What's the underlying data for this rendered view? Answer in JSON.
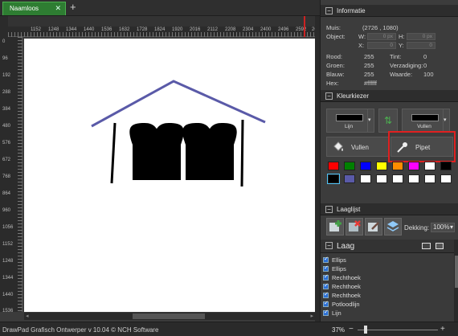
{
  "tab": {
    "title": "Naamloos",
    "close": "✕",
    "add": "+"
  },
  "ruler_top": [
    "1152",
    "1248",
    "1344",
    "1440",
    "1536",
    "1632",
    "1728",
    "1824",
    "1920",
    "2016",
    "2112",
    "2208",
    "2304",
    "2400",
    "2496",
    "2592",
    "2688",
    "27"
  ],
  "ruler_left": [
    "0",
    "96",
    "192",
    "288",
    "384",
    "480",
    "576",
    "672",
    "768",
    "864",
    "960",
    "1056",
    "1152",
    "1248",
    "1344",
    "1440",
    "1536"
  ],
  "statusbar": {
    "text": "DrawPad Grafisch Ontwerper v 10.04 © NCH Software",
    "zoom": "37%",
    "zoom_minus": "−",
    "zoom_plus": "+",
    "zoom_level": 0.08
  },
  "info": {
    "title": "Informatie",
    "muis_label": "Muis:",
    "muis_value": "(2726 , 1080)",
    "object_label": "Object:",
    "w_label": "W:",
    "w_value": "0 px",
    "h_label": "H:",
    "h_value": "0 px",
    "x_label": "X:",
    "x_value": "0",
    "y_label": "Y:",
    "y_value": "0",
    "rood_label": "Rood:",
    "rood_value": "255",
    "groen_label": "Groen:",
    "groen_value": "255",
    "blauw_label": "Blauw:",
    "blauw_value": "255",
    "hex_label": "Hex:",
    "hex_value": "#ffffff",
    "tint_label": "Tint:",
    "tint_value": "0",
    "verzadiging_label": "Verzadiging:",
    "verzadiging_value": "0",
    "waarde_label": "Waarde:",
    "waarde_value": "100"
  },
  "kleurkiezer": {
    "title": "Kleurkiezer",
    "lijn_label": "Lijn",
    "vullen_label": "Vullen",
    "fill_button": "Vullen",
    "pipet_button": "Pipet",
    "palette": [
      "#ff0000",
      "#008000",
      "#0000ff",
      "#ffff00",
      "#ff8c00",
      "#ff00ff",
      "#ffffff",
      "#000000",
      "#000000",
      "#5a5aa8",
      "#ffffff",
      "#ffffff",
      "#ffffff",
      "#ffffff",
      "#ffffff",
      "#ffffff"
    ]
  },
  "laaglijst": {
    "title": "Laaglijst",
    "dekking_label": "Dekking:",
    "dekking_value": "100%",
    "laag_title": "Laag",
    "layers": [
      "Ellips",
      "Ellips",
      "Rechthoek",
      "Rechthoek",
      "Rechthoek",
      "Potloodlijn",
      "Lijn"
    ]
  },
  "colors": {
    "roof": "#5a5aa8",
    "accent": "#2e7d32",
    "highlight": "#e02020"
  }
}
